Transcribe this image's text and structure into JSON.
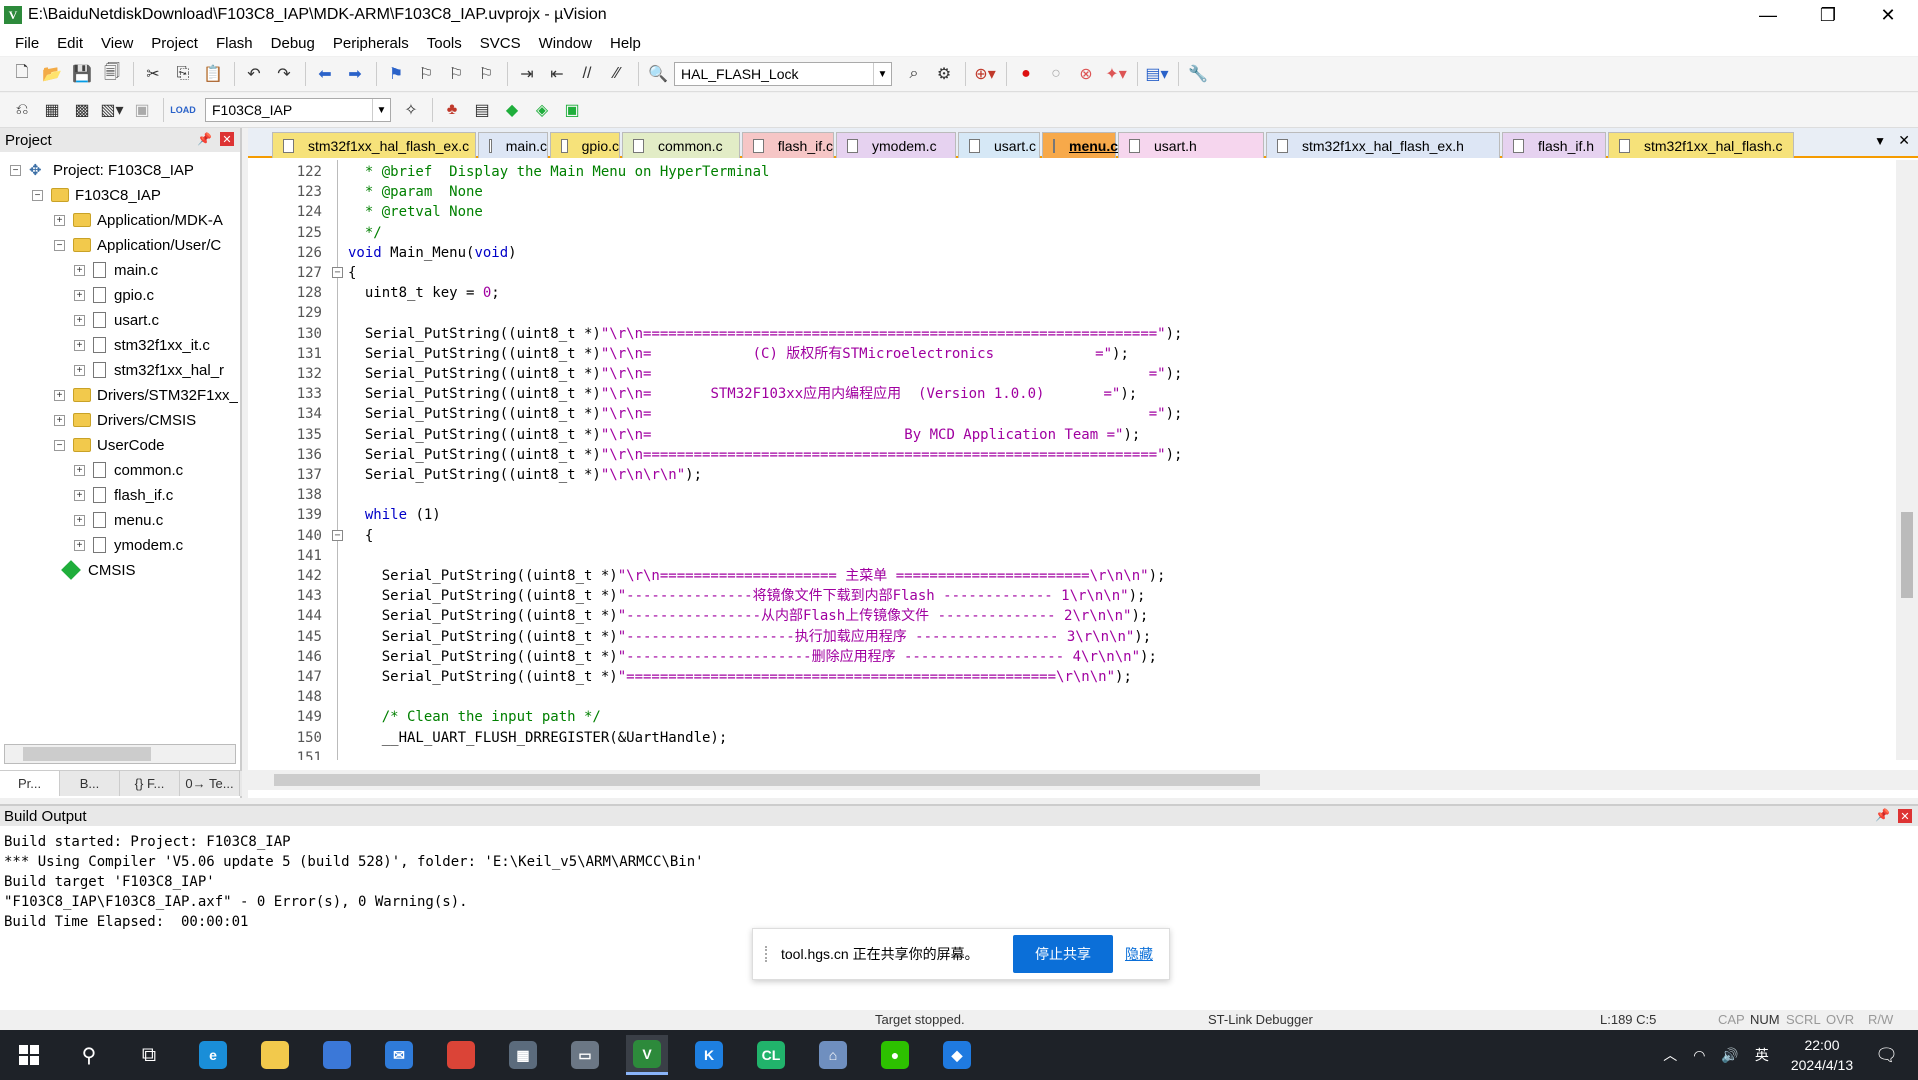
{
  "window": {
    "title": "E:\\BaiduNetdiskDownload\\F103C8_IAP\\MDK-ARM\\F103C8_IAP.uvprojx - µVision",
    "icon_letter": "V"
  },
  "menu": [
    "File",
    "Edit",
    "View",
    "Project",
    "Flash",
    "Debug",
    "Peripherals",
    "Tools",
    "SVCS",
    "Window",
    "Help"
  ],
  "toolbar1": {
    "function_combo": "HAL_FLASH_Lock"
  },
  "toolbar2": {
    "target_combo": "F103C8_IAP",
    "load_label": "LOAD"
  },
  "project_panel": {
    "title": "Project",
    "tree": [
      {
        "label": "Project: F103C8_IAP",
        "exp": "⊟",
        "kind": "project"
      },
      {
        "label": "F103C8_IAP",
        "exp": "⊟",
        "kind": "folder"
      },
      {
        "label": "Application/MDK-A",
        "exp": "⊞",
        "kind": "folder"
      },
      {
        "label": "Application/User/C",
        "exp": "⊟",
        "kind": "folder"
      },
      {
        "label": "main.c",
        "exp": "⊞",
        "kind": "file"
      },
      {
        "label": "gpio.c",
        "exp": "⊞",
        "kind": "file"
      },
      {
        "label": "usart.c",
        "exp": "⊞",
        "kind": "file"
      },
      {
        "label": "stm32f1xx_it.c",
        "exp": "⊞",
        "kind": "file"
      },
      {
        "label": "stm32f1xx_hal_r",
        "exp": "⊞",
        "kind": "file"
      },
      {
        "label": "Drivers/STM32F1xx_",
        "exp": "⊞",
        "kind": "folder"
      },
      {
        "label": "Drivers/CMSIS",
        "exp": "⊞",
        "kind": "folder"
      },
      {
        "label": "UserCode",
        "exp": "⊟",
        "kind": "folder"
      },
      {
        "label": "common.c",
        "exp": "⊞",
        "kind": "file"
      },
      {
        "label": "flash_if.c",
        "exp": "⊞",
        "kind": "file"
      },
      {
        "label": "menu.c",
        "exp": "⊞",
        "kind": "file"
      },
      {
        "label": "ymodem.c",
        "exp": "⊞",
        "kind": "file"
      },
      {
        "label": "CMSIS",
        "exp": "",
        "kind": "cmsis"
      }
    ],
    "tabs": [
      "Pr...",
      "B...",
      "{} F...",
      "0→ Te..."
    ]
  },
  "tabs": [
    {
      "label": "stm32f1xx_hal_flash_ex.c",
      "color": "#f6e27a"
    },
    {
      "label": "main.c",
      "color": "#dde6f5"
    },
    {
      "label": "gpio.c",
      "color": "#f6e27a"
    },
    {
      "label": "common.c",
      "color": "#e2ecc6"
    },
    {
      "label": "flash_if.c",
      "color": "#f6c6c6"
    },
    {
      "label": "ymodem.c",
      "color": "#e6d2f0"
    },
    {
      "label": "usart.c",
      "color": "#d6e8f6"
    },
    {
      "label": "menu.c",
      "color": "#f7a94a"
    },
    {
      "label": "usart.h",
      "color": "#f6d6ee"
    },
    {
      "label": "stm32f1xx_hal_flash_ex.h",
      "color": "#dde6f5"
    },
    {
      "label": "flash_if.h",
      "color": "#e6d2f0"
    },
    {
      "label": "stm32f1xx_hal_flash.c",
      "color": "#f6e27a"
    }
  ],
  "code": [
    {
      "n": "122",
      "segs": [
        {
          "c": "cm",
          "t": "  * @brief  Display the Main Menu on HyperTerminal"
        }
      ]
    },
    {
      "n": "123",
      "segs": [
        {
          "c": "cm",
          "t": "  * @param  None"
        }
      ]
    },
    {
      "n": "124",
      "segs": [
        {
          "c": "cm",
          "t": "  * @retval None"
        }
      ]
    },
    {
      "n": "125",
      "segs": [
        {
          "c": "cm",
          "t": "  */"
        }
      ]
    },
    {
      "n": "126",
      "segs": [
        {
          "c": "kw",
          "t": "void"
        },
        {
          "c": "",
          "t": " Main_Menu("
        },
        {
          "c": "kw",
          "t": "void"
        },
        {
          "c": "",
          "t": ")"
        }
      ]
    },
    {
      "n": "127",
      "fold": "⊟",
      "segs": [
        {
          "c": "",
          "t": "{"
        }
      ]
    },
    {
      "n": "128",
      "segs": [
        {
          "c": "",
          "t": "  uint8_t key = "
        },
        {
          "c": "num",
          "t": "0"
        },
        {
          "c": "",
          "t": ";"
        }
      ]
    },
    {
      "n": "129",
      "segs": []
    },
    {
      "n": "130",
      "segs": [
        {
          "c": "",
          "t": "  Serial_PutString((uint8_t *)"
        },
        {
          "c": "str",
          "t": "\"\\r\\n=============================================================\""
        },
        {
          "c": "",
          "t": ");"
        }
      ]
    },
    {
      "n": "131",
      "segs": [
        {
          "c": "",
          "t": "  Serial_PutString((uint8_t *)"
        },
        {
          "c": "str",
          "t": "\"\\r\\n=            (C) 版权所有STMicroelectronics            =\""
        },
        {
          "c": "",
          "t": ");"
        }
      ]
    },
    {
      "n": "132",
      "segs": [
        {
          "c": "",
          "t": "  Serial_PutString((uint8_t *)"
        },
        {
          "c": "str",
          "t": "\"\\r\\n=                                                           =\""
        },
        {
          "c": "",
          "t": ");"
        }
      ]
    },
    {
      "n": "133",
      "segs": [
        {
          "c": "",
          "t": "  Serial_PutString((uint8_t *)"
        },
        {
          "c": "str",
          "t": "\"\\r\\n=       STM32F103xx应用内编程应用  (Version 1.0.0)       =\""
        },
        {
          "c": "",
          "t": ");"
        }
      ]
    },
    {
      "n": "134",
      "segs": [
        {
          "c": "",
          "t": "  Serial_PutString((uint8_t *)"
        },
        {
          "c": "str",
          "t": "\"\\r\\n=                                                           =\""
        },
        {
          "c": "",
          "t": ");"
        }
      ]
    },
    {
      "n": "135",
      "segs": [
        {
          "c": "",
          "t": "  Serial_PutString((uint8_t *)"
        },
        {
          "c": "str",
          "t": "\"\\r\\n=                              By MCD Application Team =\""
        },
        {
          "c": "",
          "t": ");"
        }
      ]
    },
    {
      "n": "136",
      "segs": [
        {
          "c": "",
          "t": "  Serial_PutString((uint8_t *)"
        },
        {
          "c": "str",
          "t": "\"\\r\\n=============================================================\""
        },
        {
          "c": "",
          "t": ");"
        }
      ]
    },
    {
      "n": "137",
      "segs": [
        {
          "c": "",
          "t": "  Serial_PutString((uint8_t *)"
        },
        {
          "c": "str",
          "t": "\"\\r\\n\\r\\n\""
        },
        {
          "c": "",
          "t": ");"
        }
      ]
    },
    {
      "n": "138",
      "segs": []
    },
    {
      "n": "139",
      "segs": [
        {
          "c": "kw",
          "t": "  while"
        },
        {
          "c": "",
          "t": " (1)"
        }
      ]
    },
    {
      "n": "140",
      "fold": "⊟",
      "segs": [
        {
          "c": "",
          "t": "  {"
        }
      ]
    },
    {
      "n": "141",
      "segs": []
    },
    {
      "n": "142",
      "segs": [
        {
          "c": "",
          "t": "    Serial_PutString((uint8_t *)"
        },
        {
          "c": "str",
          "t": "\"\\r\\n===================== 主菜单 =======================\\r\\n\\n\""
        },
        {
          "c": "",
          "t": ");"
        }
      ]
    },
    {
      "n": "143",
      "segs": [
        {
          "c": "",
          "t": "    Serial_PutString((uint8_t *)"
        },
        {
          "c": "str",
          "t": "\"---------------将镜像文件下载到内部Flash ------------- 1\\r\\n\\n\""
        },
        {
          "c": "",
          "t": ");"
        }
      ]
    },
    {
      "n": "144",
      "segs": [
        {
          "c": "",
          "t": "    Serial_PutString((uint8_t *)"
        },
        {
          "c": "str",
          "t": "\"----------------从内部Flash上传镜像文件 -------------- 2\\r\\n\\n\""
        },
        {
          "c": "",
          "t": ");"
        }
      ]
    },
    {
      "n": "145",
      "segs": [
        {
          "c": "",
          "t": "    Serial_PutString((uint8_t *)"
        },
        {
          "c": "str",
          "t": "\"--------------------执行加载应用程序 ----------------- 3\\r\\n\\n\""
        },
        {
          "c": "",
          "t": ");"
        }
      ]
    },
    {
      "n": "146",
      "segs": [
        {
          "c": "",
          "t": "    Serial_PutString((uint8_t *)"
        },
        {
          "c": "str",
          "t": "\"----------------------删除应用程序 ------------------- 4\\r\\n\\n\""
        },
        {
          "c": "",
          "t": ");"
        }
      ]
    },
    {
      "n": "147",
      "segs": [
        {
          "c": "",
          "t": "    Serial_PutString((uint8_t *)"
        },
        {
          "c": "str",
          "t": "\"===================================================\\r\\n\\n\""
        },
        {
          "c": "",
          "t": ");"
        }
      ]
    },
    {
      "n": "148",
      "segs": []
    },
    {
      "n": "149",
      "segs": [
        {
          "c": "cm",
          "t": "    /* Clean the input path */"
        }
      ]
    },
    {
      "n": "150",
      "segs": [
        {
          "c": "",
          "t": "    __HAL_UART_FLUSH_DRREGISTER(&UartHandle);"
        }
      ]
    },
    {
      "n": "151",
      "segs": []
    }
  ],
  "build_output": {
    "title": "Build Output",
    "lines": [
      "Build started: Project: F103C8_IAP",
      "*** Using Compiler 'V5.06 update 5 (build 528)', folder: 'E:\\Keil_v5\\ARM\\ARMCC\\Bin'",
      "Build target 'F103C8_IAP'",
      "\"F103C8_IAP\\F103C8_IAP.axf\" - 0 Error(s), 0 Warning(s).",
      "Build Time Elapsed:  00:00:01"
    ]
  },
  "share_banner": {
    "message": "tool.hgs.cn 正在共享你的屏幕。",
    "stop_label": "停止共享",
    "hide_label": "隐藏"
  },
  "status": {
    "target": "Target stopped.",
    "debugger": "ST-Link Debugger",
    "position": "L:189 C:5",
    "caps": "CAP",
    "num": "NUM",
    "scrl": "SCRL",
    "ovr": "OVR",
    "rw": "R/W"
  },
  "taskbar": {
    "time": "22:00",
    "date": "2024/4/13",
    "ime": "英",
    "apps": [
      {
        "name": "edge-icon",
        "glyph": "e",
        "color": "#1a8ed8"
      },
      {
        "name": "file-explorer-icon",
        "glyph": "",
        "color": "#f2c94c"
      },
      {
        "name": "store-icon",
        "glyph": "",
        "color": "#3b78d8"
      },
      {
        "name": "mail-icon",
        "glyph": "✉",
        "color": "#2f7bd9"
      },
      {
        "name": "chrome-icon",
        "glyph": "",
        "color": "#db4437"
      },
      {
        "name": "calculator-icon",
        "glyph": "▦",
        "color": "#5b6b7c"
      },
      {
        "name": "app-window-icon",
        "glyph": "▭",
        "color": "#6b7785"
      },
      {
        "name": "keil-icon",
        "glyph": "V",
        "color": "#2d8a3b"
      },
      {
        "name": "kugou-icon",
        "glyph": "K",
        "color": "#1e7fe0"
      },
      {
        "name": "clion-icon",
        "glyph": "CL",
        "color": "#21b36b"
      },
      {
        "name": "network-app-icon",
        "glyph": "⌂",
        "color": "#6f8fbf"
      },
      {
        "name": "wechat-icon",
        "glyph": "●",
        "color": "#2dc100"
      },
      {
        "name": "feishu-icon",
        "glyph": "◆",
        "color": "#1f7ae0"
      }
    ]
  },
  "colors": {
    "accent_tab": "#f59b00",
    "keyword": "#0000c8",
    "comment": "#008000",
    "string": "#a000a0",
    "taskbar": "#1e2228"
  }
}
